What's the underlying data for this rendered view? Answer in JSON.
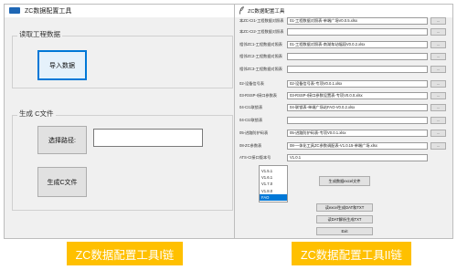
{
  "window1": {
    "title": "ZC数据配置工具",
    "read_group_label": "读取工程数据",
    "import_button": "导入数据",
    "generate_group_label": "生成 C文件",
    "path_button": "选择路径:",
    "path_value": "",
    "generate_button": "生成C文件"
  },
  "window2": {
    "title": "ZC数据配置工具",
    "rows": [
      {
        "label": "本ZC-CI1-工程数据对照表",
        "value": "01-工程数据对照表-单端广场V0.0.5.xlsx",
        "button": "..."
      },
      {
        "label": "本ZC-CI2-工程数据对照表",
        "value": "",
        "button": "..."
      },
      {
        "label": "相邻ZC1-工程数据对照表",
        "value": "01-工程数据对照表-南湖车站幅段V0.0.2.xlsx",
        "button": "..."
      },
      {
        "label": "相邻ZC2-工程数据对照表",
        "value": "",
        "button": "..."
      },
      {
        "label": "相邻ZC3-工程数据对照表",
        "value": "",
        "button": "..."
      },
      {
        "label": "02-设备信号表",
        "value": "02-设备信号表-专项V0.0.1.xlsx",
        "button": "..."
      },
      {
        "label": "03-RSSP-I接口参数表",
        "value": "03-RSSP-I接口参数设置表-专项V0.0.0.xlsx",
        "button": "..."
      },
      {
        "label": "04-CI1联锁表",
        "value": "04-联锁表-单端广场站FAO-V0.0.2.xlsx",
        "button": "..."
      },
      {
        "label": "04-CI2联锁表",
        "value": "",
        "button": "..."
      },
      {
        "label": "05-进路防护码表",
        "value": "05-进路防护码表-专项V0.0.1.xlsx",
        "button": "..."
      },
      {
        "label": "08-ZC参数表",
        "value": "08-一体化工具ZC参数调配表-V1.0.15-单端广场.xlsx",
        "button": "..."
      },
      {
        "label": "ATS-CI接口版本号",
        "value": "V1.0.1",
        "button": ""
      }
    ],
    "versions": [
      "V1.5.1",
      "V1.6.1",
      "V1.7.0",
      "V1.8.0",
      "FAO"
    ],
    "selected_version": "FAO",
    "generate_excel_button": "生成数据excel文件",
    "excel_to_dat_button": "读excel生成DAT和TXT",
    "dat_to_txt_button": "读DAT解析生成TXT",
    "exit_button": "Exit"
  },
  "captions": {
    "left": "ZC数据配置工具I链",
    "right": "ZC数据配置工具II链"
  },
  "colors": {
    "caption_bg": "#ffc000",
    "selection": "#0078d7",
    "window_bg": "#f0f0f0"
  }
}
